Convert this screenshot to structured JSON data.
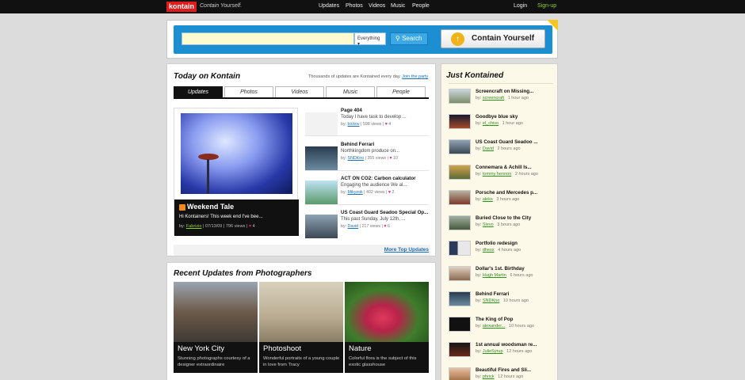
{
  "header": {
    "logo": "kontain",
    "tagline": "Contain Yourself.",
    "nav": [
      "Updates",
      "Photos",
      "Videos",
      "Music",
      "People"
    ],
    "login": "Login",
    "signup": "Sign-up"
  },
  "search": {
    "filter": "Everything ▾",
    "button": "Search",
    "contain_button": "Contain Yourself"
  },
  "today": {
    "title": "Today on Kontain",
    "subtitle": "Thousands of updates are Kontained every day.",
    "join": "Join the party",
    "tabs": [
      "Updates",
      "Photos",
      "Videos",
      "Music",
      "People"
    ],
    "active_tab": "Updates",
    "feature": {
      "title": "Weekend Tale",
      "desc": "Hi Kontainers! This week end I've bee...",
      "by": "by:",
      "user": "Fabrizio",
      "date": "07/13/09",
      "views": "796 views",
      "likes": "4"
    },
    "stories": [
      {
        "title": "Page 404",
        "desc": "Today I have task to develop ...",
        "user": "bickov",
        "views": "598 views",
        "likes": "4"
      },
      {
        "title": "Behind Ferrari",
        "desc": "Northkingdom produce on...",
        "user": "SNDKno",
        "views": "355 views",
        "likes": "10"
      },
      {
        "title": "ACT ON CO2: Carbon calculator",
        "desc": "Engaging the audience   We al...",
        "user": "Mikyzok",
        "views": "402 views",
        "likes": "2"
      },
      {
        "title": "US Coast Guard Seadoo Special Op...",
        "desc": "This past Sunday, July 12th, ...",
        "user": "David",
        "views": "217 views",
        "likes": "6"
      }
    ],
    "more": "More Top Updates"
  },
  "recent": {
    "title": "Recent Updates from Photographers",
    "photos": [
      {
        "title": "New York City",
        "desc": "Stunning photographs courtesy of a designer extraordinaire"
      },
      {
        "title": "Photoshoot",
        "desc": "Wonderful portraits of a young couple in love from Tracy"
      },
      {
        "title": "Nature",
        "desc": "Colorful flora is the subject of this exotic glasshouse"
      }
    ]
  },
  "just": {
    "title": "Just Kontained",
    "items": [
      {
        "title": "Screencraft on Missing...",
        "user": "screencraft",
        "time": "1 hour ago"
      },
      {
        "title": "Goodbye blue sky",
        "user": "el_chivo",
        "time": "1 hour ago"
      },
      {
        "title": "US Coast Guard Seadoo ...",
        "user": "David",
        "time": "2 hours ago"
      },
      {
        "title": "Connemara & Achill Is...",
        "user": "tommy hennon",
        "time": "2 hours ago"
      },
      {
        "title": "Porsche and Mercedes p...",
        "user": "aleks",
        "time": "3 hours ago"
      },
      {
        "title": "Buried Close to the City",
        "user": "Slevo",
        "time": "3 hours ago"
      },
      {
        "title": "Portfolio redesign",
        "user": "dhess",
        "time": "4 hours ago"
      },
      {
        "title": "Dollar's 1st. Birthday",
        "user": "Hugh Martin",
        "time": "6 hours ago"
      },
      {
        "title": "Behind Ferrari",
        "user": "SNDKno",
        "time": "10 hours ago"
      },
      {
        "title": "The King of Pop",
        "user": "alexander...",
        "time": "10 hours ago"
      },
      {
        "title": "1st annual woodsman re...",
        "user": "JulieSyrup",
        "time": "12 hours ago"
      },
      {
        "title": "Beautiful Fires and Sli...",
        "user": "phrick",
        "time": "12 hours ago"
      }
    ]
  }
}
